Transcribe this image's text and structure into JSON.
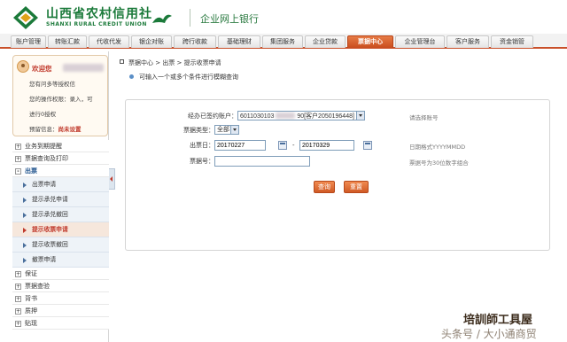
{
  "header": {
    "bank_name_cn": "山西省农村信用社",
    "bank_name_en": "SHANXI RURAL CREDIT UNION",
    "system_title": "企业网上银行",
    "brand_color": "#1b7a3a"
  },
  "topnav": {
    "tabs": [
      {
        "label": "账户管理"
      },
      {
        "label": "转账汇款"
      },
      {
        "label": "代收代发"
      },
      {
        "label": "银企对账"
      },
      {
        "label": "跨行收款"
      },
      {
        "label": "基础理财"
      },
      {
        "label": "集团服务"
      },
      {
        "label": "企业贷款"
      },
      {
        "label": "票据中心"
      },
      {
        "label": "企业管理台"
      },
      {
        "label": "客户服务"
      },
      {
        "label": "资金销管"
      }
    ],
    "active": "票据中心",
    "accent_color": "#c94d1e"
  },
  "user": {
    "welcome": "欢迎您",
    "line1": "您有问多等授权信",
    "line2": "您的操作权限：录入，可",
    "line3": "进行0授权",
    "line4_prefix": "预留信息：",
    "line4_value": "尚未设置"
  },
  "menu": {
    "groups_top": [
      {
        "label": "业务到期提醒",
        "symbol": "+"
      },
      {
        "label": "票据查询及打印",
        "symbol": "+"
      },
      {
        "label": "出票",
        "symbol": "-"
      }
    ],
    "sub_items": [
      {
        "label": "出票申请"
      },
      {
        "label": "提示承兑申请"
      },
      {
        "label": "提示承兑撤回"
      },
      {
        "label": "提示收票申请"
      },
      {
        "label": "提示收票撤回"
      },
      {
        "label": "撤票申请"
      }
    ],
    "active_sub": "提示收票申请",
    "groups_bottom": [
      {
        "label": "保证",
        "symbol": "+"
      },
      {
        "label": "票据查验",
        "symbol": "+"
      },
      {
        "label": "背书",
        "symbol": "+"
      },
      {
        "label": "质押",
        "symbol": "+"
      },
      {
        "label": "贴现",
        "symbol": "+"
      }
    ]
  },
  "breadcrumb": "票据中心 > 出票 > 提示收票申请",
  "hint": "可输入一个或多个条件进行模糊查询",
  "form": {
    "account_label": "经办已签约账户：",
    "account_value": "6011030103",
    "account_tail": "90[客户2050196448]",
    "account_note": "请选择账号",
    "type_label": "票据类型：",
    "type_value": "全部",
    "date_label": "出票日：",
    "date_from": "20170227",
    "date_sep": "-",
    "date_to": "20170329",
    "date_note": "日期格式YYYYMMDD",
    "number_label": "票据号：",
    "number_value": "",
    "number_note": "票据号为30位数字组合",
    "query_button": "查询",
    "reset_button": "重置"
  },
  "watermark": {
    "line1": "培訓師工具屋",
    "line2": "头条号 / 大小通商贸"
  }
}
